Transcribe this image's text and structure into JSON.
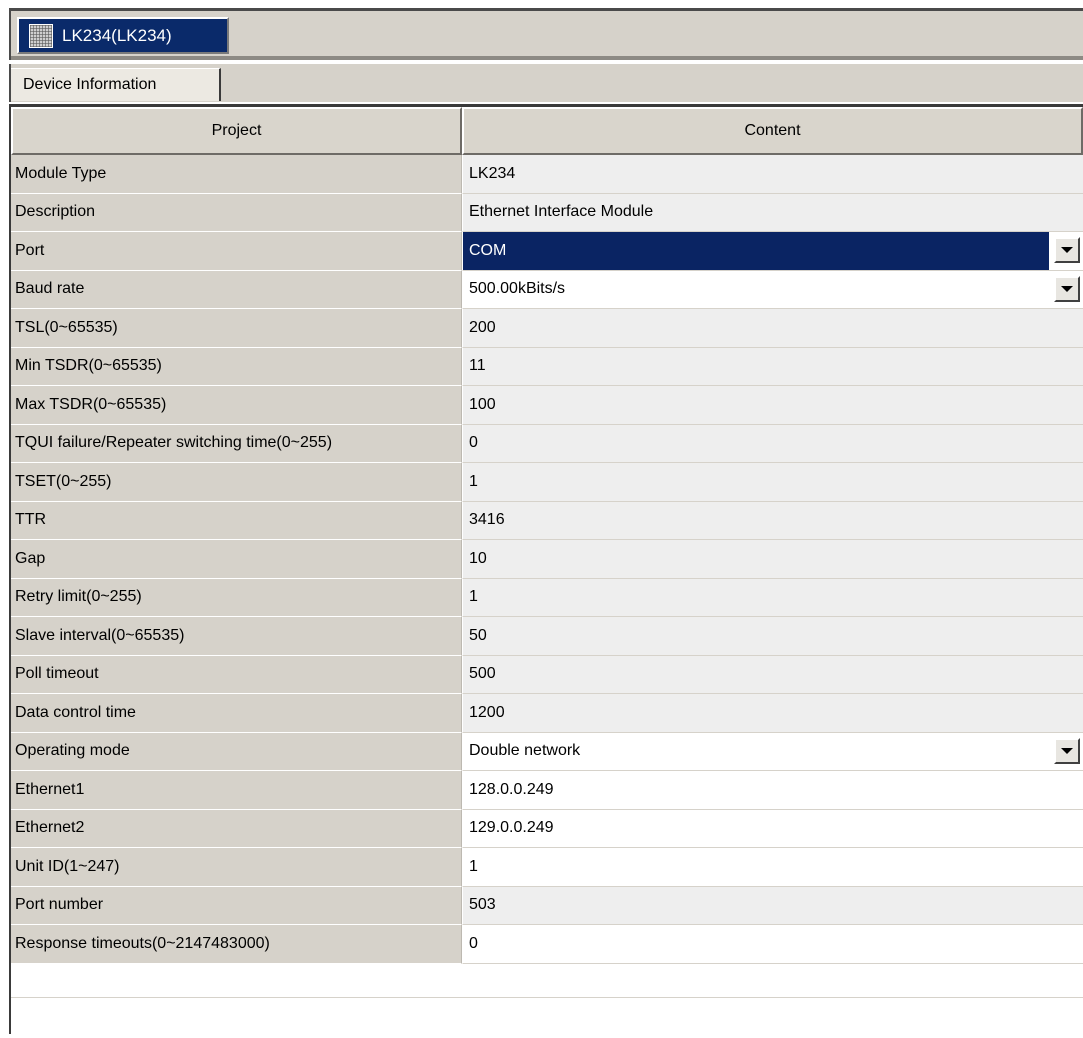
{
  "document_tab": {
    "label": "LK234(LK234)",
    "icon": "module-icon"
  },
  "sub_tab": {
    "label": "Device Information"
  },
  "grid": {
    "headers": {
      "project": "Project",
      "content": "Content"
    },
    "rows": [
      {
        "name": "Module Type",
        "value": "LK234",
        "kind": "readonly"
      },
      {
        "name": "Description",
        "value": "Ethernet Interface Module",
        "kind": "readonly"
      },
      {
        "name": "Port",
        "value": "COM",
        "kind": "dropdown",
        "selected": true
      },
      {
        "name": "Baud rate",
        "value": "500.00kBits/s",
        "kind": "dropdown"
      },
      {
        "name": "TSL(0~65535)",
        "value": "200",
        "kind": "readonly"
      },
      {
        "name": "Min TSDR(0~65535)",
        "value": "11",
        "kind": "readonly"
      },
      {
        "name": "Max TSDR(0~65535)",
        "value": "100",
        "kind": "readonly"
      },
      {
        "name": "TQUI failure/Repeater switching time(0~255)",
        "value": "0",
        "kind": "readonly"
      },
      {
        "name": "TSET(0~255)",
        "value": "1",
        "kind": "readonly"
      },
      {
        "name": "TTR",
        "value": "3416",
        "kind": "readonly"
      },
      {
        "name": "Gap",
        "value": "10",
        "kind": "readonly"
      },
      {
        "name": "Retry limit(0~255)",
        "value": "1",
        "kind": "readonly"
      },
      {
        "name": "Slave interval(0~65535)",
        "value": "50",
        "kind": "readonly"
      },
      {
        "name": "Poll timeout",
        "value": "500",
        "kind": "readonly"
      },
      {
        "name": "Data control time",
        "value": "1200",
        "kind": "readonly"
      },
      {
        "name": "Operating mode",
        "value": "Double network",
        "kind": "dropdown"
      },
      {
        "name": "Ethernet1",
        "value": "128.0.0.249",
        "kind": "editable"
      },
      {
        "name": "Ethernet2",
        "value": "129.0.0.249",
        "kind": "editable"
      },
      {
        "name": "Unit ID(1~247)",
        "value": "1",
        "kind": "editable"
      },
      {
        "name": "Port number",
        "value": "503",
        "kind": "readonly"
      },
      {
        "name": "Response timeouts(0~2147483000)",
        "value": "0",
        "kind": "editable"
      }
    ]
  },
  "colors": {
    "selection": "#0a2463",
    "panel": "#d6d2ca",
    "readonly_cell": "#eeeeee",
    "editable_cell": "#ffffff"
  }
}
